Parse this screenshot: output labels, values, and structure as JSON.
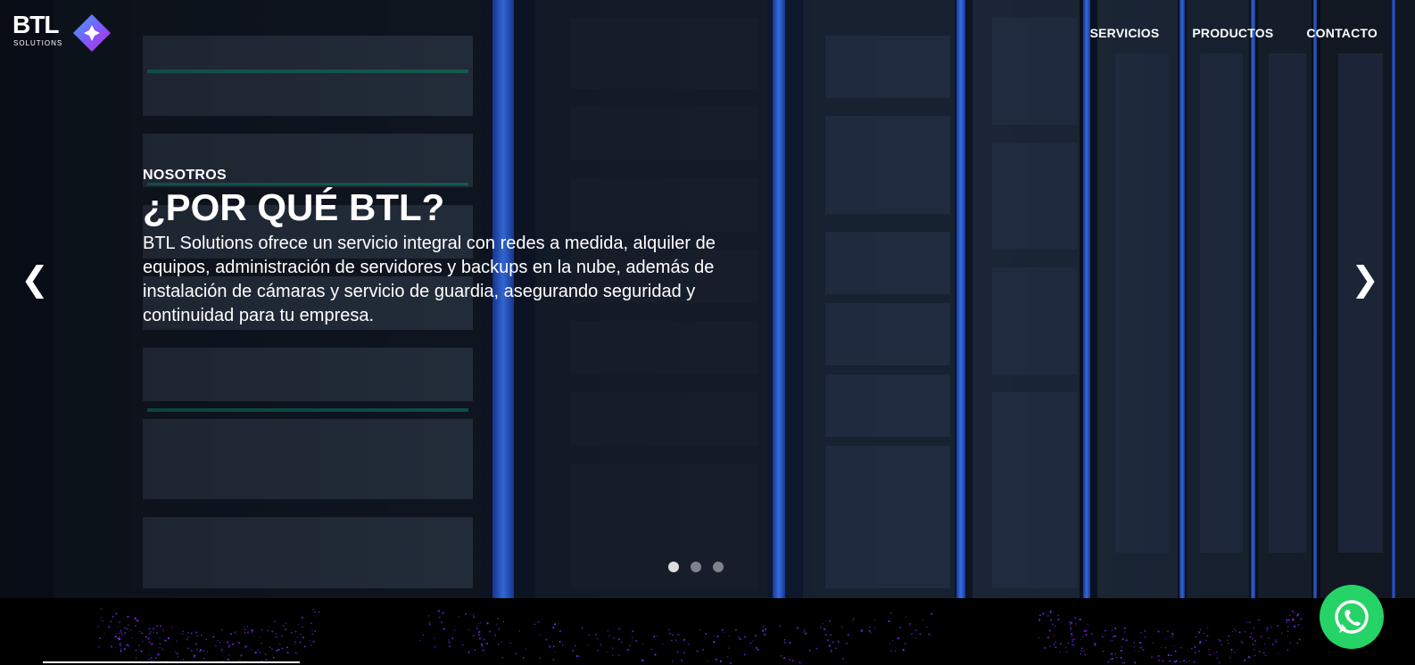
{
  "brand": {
    "name": "BTL",
    "tagline": "SOLUTIONS"
  },
  "nav": {
    "items": [
      "SERVICIOS",
      "PRODUCTOS",
      "CONTACTO"
    ]
  },
  "hero": {
    "eyebrow": "NOSOTROS",
    "title": "¿POR QUÉ BTL?",
    "description": "BTL Solutions ofrece un servicio integral con redes a medida, alquiler de equipos, administración de servidores y backups en la nube, además de instalación de cámaras y servicio de guardia, asegurando seguridad y continuidad para tu empresa.",
    "prev_icon": "chevron-left-icon",
    "next_icon": "chevron-right-icon",
    "prev_glyph": "❮",
    "next_glyph": "❯",
    "slides_count": 3,
    "active_slide": 1
  },
  "floating": {
    "whatsapp_icon": "whatsapp-icon"
  },
  "colors": {
    "accent_purple": "#7b2ff7",
    "whatsapp_green": "#25d366",
    "rack_blue": "#2f6bff"
  }
}
